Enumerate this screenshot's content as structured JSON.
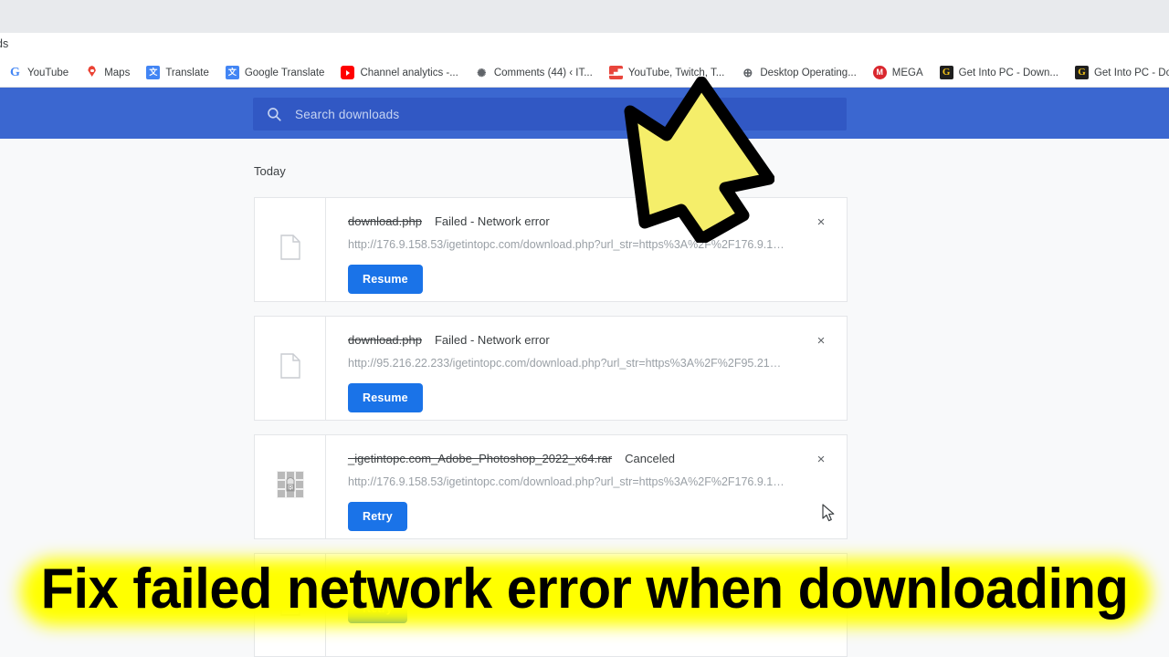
{
  "browser": {
    "omnibox_fragment": "ds",
    "bookmarks": [
      {
        "label": "YouTube",
        "icon": "google-icon",
        "icon_class": "ico-google",
        "glyph": "G"
      },
      {
        "label": "Maps",
        "icon": "maps-pin-icon",
        "icon_class": "ico-maps",
        "glyph": ""
      },
      {
        "label": "Translate",
        "icon": "translate-icon",
        "icon_class": "ico-translate",
        "glyph": "文"
      },
      {
        "label": "Google Translate",
        "icon": "translate-icon",
        "icon_class": "ico-translate",
        "glyph": "文"
      },
      {
        "label": "Channel analytics -...",
        "icon": "youtube-icon",
        "icon_class": "ico-yt",
        "glyph": ""
      },
      {
        "label": "Comments (44) ‹ IT...",
        "icon": "comments-icon",
        "icon_class": "ico-comments",
        "glyph": "✺"
      },
      {
        "label": "YouTube, Twitch, T...",
        "icon": "bar-chart-icon",
        "icon_class": "ico-chart",
        "glyph": ""
      },
      {
        "label": "Desktop Operating...",
        "icon": "globe-icon",
        "icon_class": "ico-globe",
        "glyph": "⊕"
      },
      {
        "label": "MEGA",
        "icon": "mega-icon",
        "icon_class": "ico-mega",
        "glyph": "M"
      },
      {
        "label": "Get Into PC - Down...",
        "icon": "getintopc-icon",
        "icon_class": "ico-gip",
        "glyph": "G"
      },
      {
        "label": "Get Into PC - Down...",
        "icon": "getintopc-icon",
        "icon_class": "ico-gip",
        "glyph": "G"
      }
    ]
  },
  "downloads_page": {
    "search": {
      "placeholder": "Search downloads",
      "value": ""
    },
    "section_label": "Today",
    "header_color": "#3b67d0",
    "accent_color": "#1a73e8",
    "items": [
      {
        "filename": "download.php",
        "status": "Failed - Network error",
        "url": "http://176.9.158.53/igetintopc.com/download.php?url_str=https%3A%2F%2F176.9.1…",
        "action_label": "Resume",
        "file_type": "generic-file",
        "close_label": "×"
      },
      {
        "filename": "download.php",
        "status": "Failed - Network error",
        "url": "http://95.216.22.233/igetintopc.com/download.php?url_str=https%3A%2F%2F95.216…",
        "action_label": "Resume",
        "file_type": "generic-file",
        "close_label": "×"
      },
      {
        "filename": "_igetintopc.com_Adobe_Photoshop_2022_x64.rar",
        "status": "Canceled",
        "url": "http://176.9.158.53/igetintopc.com/download.php?url_str=https%3A%2F%2F176.9.1…",
        "action_label": "Retry",
        "file_type": "rar-archive",
        "close_label": "×"
      },
      {
        "filename": "",
        "status": "",
        "url": "",
        "action_label": "Retry",
        "file_type": "generic-file",
        "close_label": "×"
      }
    ]
  },
  "overlay": {
    "arrow_fill": "#f5ee6a",
    "arrow_stroke": "#000000",
    "caption": "Fix failed network error when downloading",
    "caption_highlight": "#ffff00",
    "caption_color": "#000000"
  }
}
